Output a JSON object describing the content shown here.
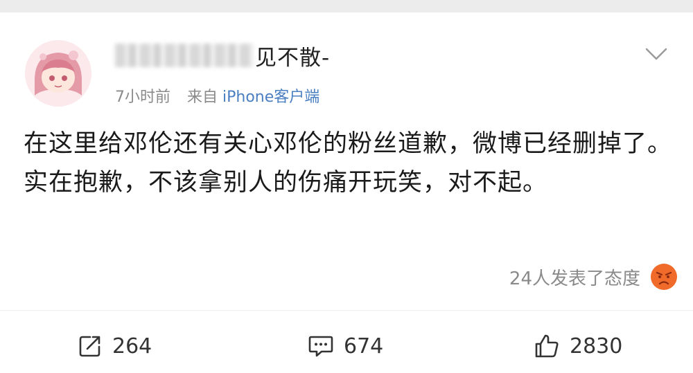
{
  "post": {
    "username_visible": "见不散-",
    "timestamp": "7小时前",
    "source_prefix": "来自",
    "device": "iPhone客户端",
    "body_line_1": "在这里给邓伦还有关心邓伦的粉丝道歉，微博已经删掉了。",
    "body_line_2": "实在抱歉，不该拿别人的伤痛开玩笑，对不起。",
    "attitude_text": "24人发表了态度"
  },
  "actions": {
    "repost_count": "264",
    "comment_count": "674",
    "like_count": "2830"
  },
  "icons": {
    "avatar": "avatar-anime-girl",
    "more": "chevron-down-icon",
    "attitude": "angry-face-icon",
    "repost": "share-icon",
    "comment": "comment-icon",
    "like": "thumbs-up-icon"
  },
  "colors": {
    "link_blue": "#4a7fc1",
    "meta_gray": "#8a8a8a",
    "emoji_orange": "#f06a2a"
  }
}
